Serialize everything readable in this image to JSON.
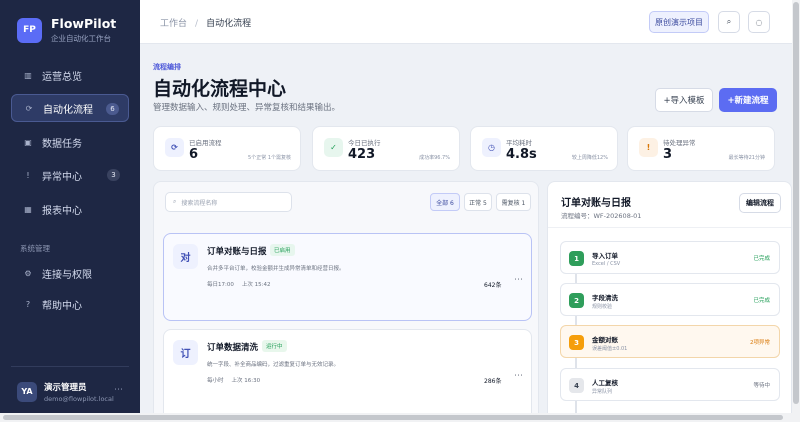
{
  "brand": {
    "logo": "FP",
    "name": "FlowPilot",
    "subtitle": "企业自动化工作台"
  },
  "sidebar": {
    "items": [
      {
        "icon": "▥",
        "label": "运营总览",
        "badge": ""
      },
      {
        "icon": "⟳",
        "label": "自动化流程",
        "badge": "6"
      },
      {
        "icon": "▣",
        "label": "数据任务",
        "badge": ""
      },
      {
        "icon": "!",
        "label": "异常中心",
        "badge": "3"
      },
      {
        "icon": "▦",
        "label": "报表中心",
        "badge": ""
      }
    ],
    "section_label": "系统管理",
    "system_items": [
      {
        "icon": "⚙",
        "label": "连接与权限"
      },
      {
        "icon": "?",
        "label": "帮助中心"
      }
    ],
    "user": {
      "initials": "YA",
      "name": "演示管理员",
      "email": "demo@flowpilot.local",
      "more": "⋯"
    }
  },
  "topbar": {
    "breadcrumb_root": "工作台",
    "breadcrumb_sep": "/",
    "breadcrumb_current": "自动化流程",
    "reset_label": "原创演示项目",
    "search_icon": "⌕",
    "settings_icon": "◌"
  },
  "header": {
    "eyebrow": "流程编排",
    "title": "自动化流程中心",
    "subtitle": "管理数据输入、规则处理、异常复核和结果输出。",
    "import_label": "+导入模板",
    "new_label": "+新建流程"
  },
  "stats": [
    {
      "icon": "⟳",
      "label": "已启用流程",
      "value": "6",
      "note": "5个正常 1个需复核",
      "bg": "#eef1fe",
      "fg": "#4050b5"
    },
    {
      "icon": "✓",
      "label": "今日已执行",
      "value": "423",
      "note": "成功率96.7%",
      "bg": "#e7f6ee",
      "fg": "#1f9d55"
    },
    {
      "icon": "◷",
      "label": "平均耗时",
      "value": "4.8s",
      "note": "较上周降低12%",
      "bg": "#eef1fe",
      "fg": "#4050b5"
    },
    {
      "icon": "!",
      "label": "待处理异常",
      "value": "3",
      "note": "最长等待21分钟",
      "bg": "#fdf1e4",
      "fg": "#d97706"
    }
  ],
  "list": {
    "search_icon": "⌕",
    "search_placeholder": "搜索流程名称",
    "filters": [
      "全部 6",
      "正常 5",
      "需复核 1"
    ],
    "workflows": [
      {
        "avatar": "对",
        "title": "订单对账与日报",
        "status": "已启用",
        "status_bg": "#e7f6ee",
        "status_fg": "#1f9d55",
        "desc": "合并多平台订单，校验金额并生成异常清单和经营日报。",
        "schedule": "每日17:00",
        "last_run": "上次 15:42",
        "count": "642条",
        "more": "⋯"
      },
      {
        "avatar": "订",
        "title": "订单数据清洗",
        "status": "运行中",
        "status_bg": "#e8f7ec",
        "status_fg": "#1f9d55",
        "desc": "统一字段、补全商品编码，过滤重复订单与无效记录。",
        "schedule": "每小时",
        "last_run": "上次 16:30",
        "count": "286条",
        "more": "⋯"
      }
    ]
  },
  "detail": {
    "title": "订单对账与日报",
    "code": "流程编号：WF-202608-01",
    "edit_label": "编辑流程",
    "steps": [
      {
        "num": "1",
        "name": "导入订单",
        "sub": "Excel / CSV",
        "state": "已完成",
        "color": "#2f9e5b",
        "state_color": "#1f9d55"
      },
      {
        "num": "2",
        "name": "字段清洗",
        "sub": "规则校验",
        "state": "已完成",
        "color": "#2f9e5b",
        "state_color": "#1f9d55"
      },
      {
        "num": "3",
        "name": "金额对账",
        "sub": "误差阈值±0.01",
        "state": "2项异常",
        "color": "#f59e0b",
        "state_color": "#d97706"
      },
      {
        "num": "4",
        "name": "人工复核",
        "sub": "异常队列",
        "state": "等待中",
        "color": "#e5e7eb",
        "state_color": "#6b7280"
      }
    ]
  }
}
